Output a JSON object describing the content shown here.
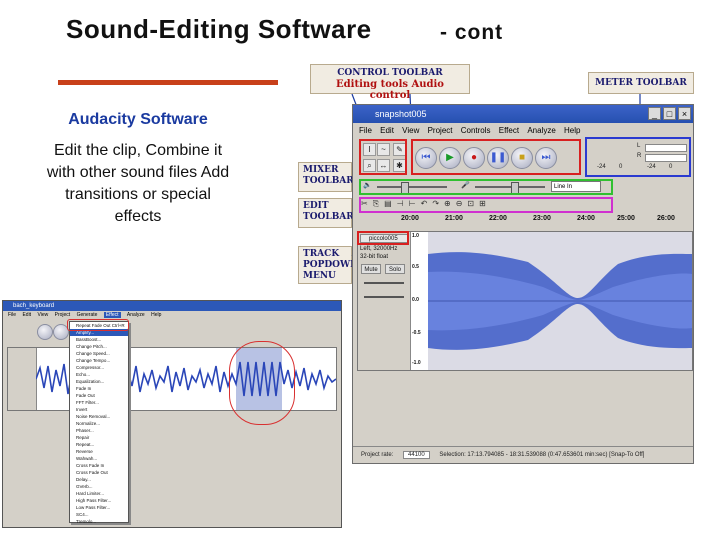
{
  "slide": {
    "title": "Sound-Editing Software",
    "title_suffix": "- cont",
    "subheading": "Audacity Software",
    "body": "Edit the clip, Combine it with other sound files Add transitions or special effects",
    "accent_color": "#c8401a",
    "subheading_color": "#1a3aa0"
  },
  "labels": {
    "control_title": "CONTROL TOOLBAR",
    "control_sub": "Editing tools   Audio control",
    "meter": "METER TOOLBAR",
    "mixer": "MIXER TOOLBAR",
    "edit": "EDIT TOOLBAR",
    "track": "TRACK POPDOWN MENU"
  },
  "big_window": {
    "title": "snapshot005",
    "menus": [
      "File",
      "Edit",
      "View",
      "Project",
      "Controls",
      "Effect",
      "Analyze",
      "Help"
    ],
    "ruler": [
      "20:00",
      "21:00",
      "22:00",
      "23:00",
      "24:00",
      "25:00",
      "26:00"
    ],
    "track_name": "piccolo005",
    "track_info": [
      "Left, 32000Hz",
      "32-bit float"
    ],
    "mute": "Mute",
    "solo": "Solo",
    "scale": [
      "1.0",
      "0.5",
      "0.0",
      "-0.5",
      "-1.0"
    ],
    "meter_scale": [
      "L",
      "R",
      "-24",
      "0",
      "-24",
      "0"
    ],
    "input_select": "Line In",
    "status_rate_label": "Project rate:",
    "status_rate": "44100",
    "status_selection": "Selection: 17:13.794085 - 18:31.539088 (0:47.653601 min:sec)  [Snap-To Off]"
  },
  "small_window": {
    "title": "bach_keyboard",
    "menus": [
      "File",
      "Edit",
      "View",
      "Project",
      "Generate",
      "Effect",
      "Analyze",
      "Help"
    ],
    "effect_menu": [
      "Repeat Fade Out  Ctrl+R",
      "Amplify...",
      "BassBoost...",
      "Change Pitch...",
      "Change Speed...",
      "Change Tempo...",
      "Compressor...",
      "Echo...",
      "Equalization...",
      "Fade In",
      "Fade Out",
      "FFT Filter...",
      "Invert",
      "Noise Removal...",
      "Normalize...",
      "Phaser...",
      "Repair",
      "Repeat...",
      "Reverse",
      "Wahwah...",
      "Cross Fade In",
      "Cross Fade Out",
      "Delay...",
      "GVerb...",
      "Hard Limiter...",
      "High Pass Filter...",
      "Low Pass Filter...",
      "SC4...",
      "Tremolo..."
    ],
    "highlight_color": "#d83030"
  },
  "icons": {
    "play": "play-icon",
    "stop": "stop-icon",
    "pause": "pause-icon",
    "record": "record-icon",
    "skip_start": "skip-start-icon",
    "skip_end": "skip-end-icon"
  }
}
